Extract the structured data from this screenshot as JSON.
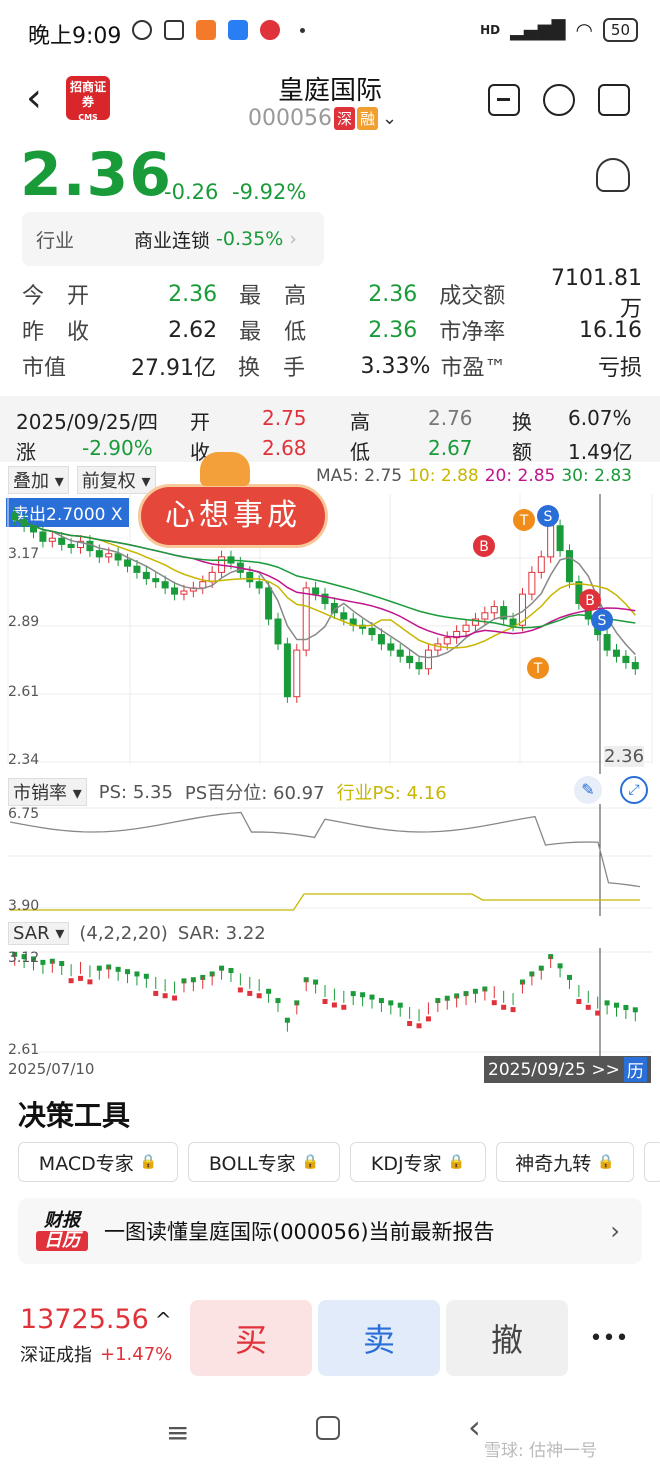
{
  "status": {
    "time": "晚上9:09",
    "signal": "HD",
    "battery": "50"
  },
  "header": {
    "back_label": "〈",
    "logo_text": "招商证券",
    "logo_sub": "CMS",
    "name": "皇庭国际",
    "code": "000056",
    "tag1": "深",
    "tag2": "融"
  },
  "quote": {
    "price": "2.36",
    "change": "-0.26",
    "pct": "-9.92%",
    "industry_label": "行业",
    "industry_name": "商业连锁",
    "industry_pct": "-0.35%"
  },
  "stats": {
    "open_label": "今 开",
    "open": "2.36",
    "high_label": "最 高",
    "high": "2.36",
    "turnover_label": "成交额",
    "turnover": "7101.81万",
    "prev_label": "昨 收",
    "prev": "2.62",
    "low_label": "最 低",
    "low": "2.36",
    "pb_label": "市净率",
    "pb": "16.16",
    "mcap_label": "市值",
    "mcap": "27.91亿",
    "hand_label": "换 手",
    "hand": "3.33%",
    "pe_label": "市盈™",
    "pe": "亏损"
  },
  "daybar": {
    "date": "2025/09/25/四",
    "open_l": "开",
    "open": "2.75",
    "high_l": "高",
    "high": "2.76",
    "turn_l": "换",
    "turn": "6.07%",
    "chg_l": "涨",
    "chg": "-2.90%",
    "close_l": "收",
    "close": "2.68",
    "low_l": "低",
    "low": "2.67",
    "amt_l": "额",
    "amt": "1.49亿"
  },
  "kline": {
    "overlay": "叠加",
    "adjust": "前复权",
    "ma_label": "MA5: 2.75",
    "ma10": "10: 2.88",
    "ma20": "20: 2.85",
    "ma30": "30: 2.83",
    "sell_marker": "卖出2.7000 X",
    "sticker": "心想事成",
    "y_top": "3.17",
    "y2": "2.89",
    "y3": "2.61",
    "y_bot": "2.34",
    "last": "2.36"
  },
  "ps": {
    "selector": "市销率",
    "ps": "PS: 5.35",
    "pct": "PS百分位: 60.97",
    "ind": "行业PS: 4.16",
    "y_top": "6.75",
    "y_bot": "3.90"
  },
  "sar": {
    "selector": "SAR",
    "params": "(4,2,2,20)",
    "value": "SAR: 3.22",
    "y_top": "3.12",
    "y_bot": "2.61",
    "start": "2025/07/10",
    "end": "2025/09/25 >>",
    "history": "历"
  },
  "tools": {
    "title": "决策工具",
    "items": [
      "MACD专家",
      "BOLL专家",
      "KDJ专家",
      "神奇九转"
    ]
  },
  "report": {
    "badge1": "财报",
    "badge2": "日历",
    "text": "一图读懂皇庭国际(000056)当前最新报告"
  },
  "index": {
    "value": "13725.56",
    "name": "深证成指",
    "pct": "+1.47%"
  },
  "trade": {
    "buy": "买",
    "sell": "卖",
    "cancel": "撤",
    "more": "•••"
  },
  "watermark": "雪球: 估神一号",
  "chart_data": {
    "type": "candlestick",
    "title": "皇庭国际 000056",
    "x_range": [
      "2025/07/10",
      "2025/09/25"
    ],
    "ylim": [
      2.34,
      3.17
    ],
    "ma": {
      "MA5": 2.75,
      "MA10": 2.88,
      "MA20": 2.85,
      "MA30": 2.83
    },
    "markers": [
      "B",
      "T",
      "S",
      "B",
      "S",
      "T"
    ],
    "last_price": 2.36
  }
}
